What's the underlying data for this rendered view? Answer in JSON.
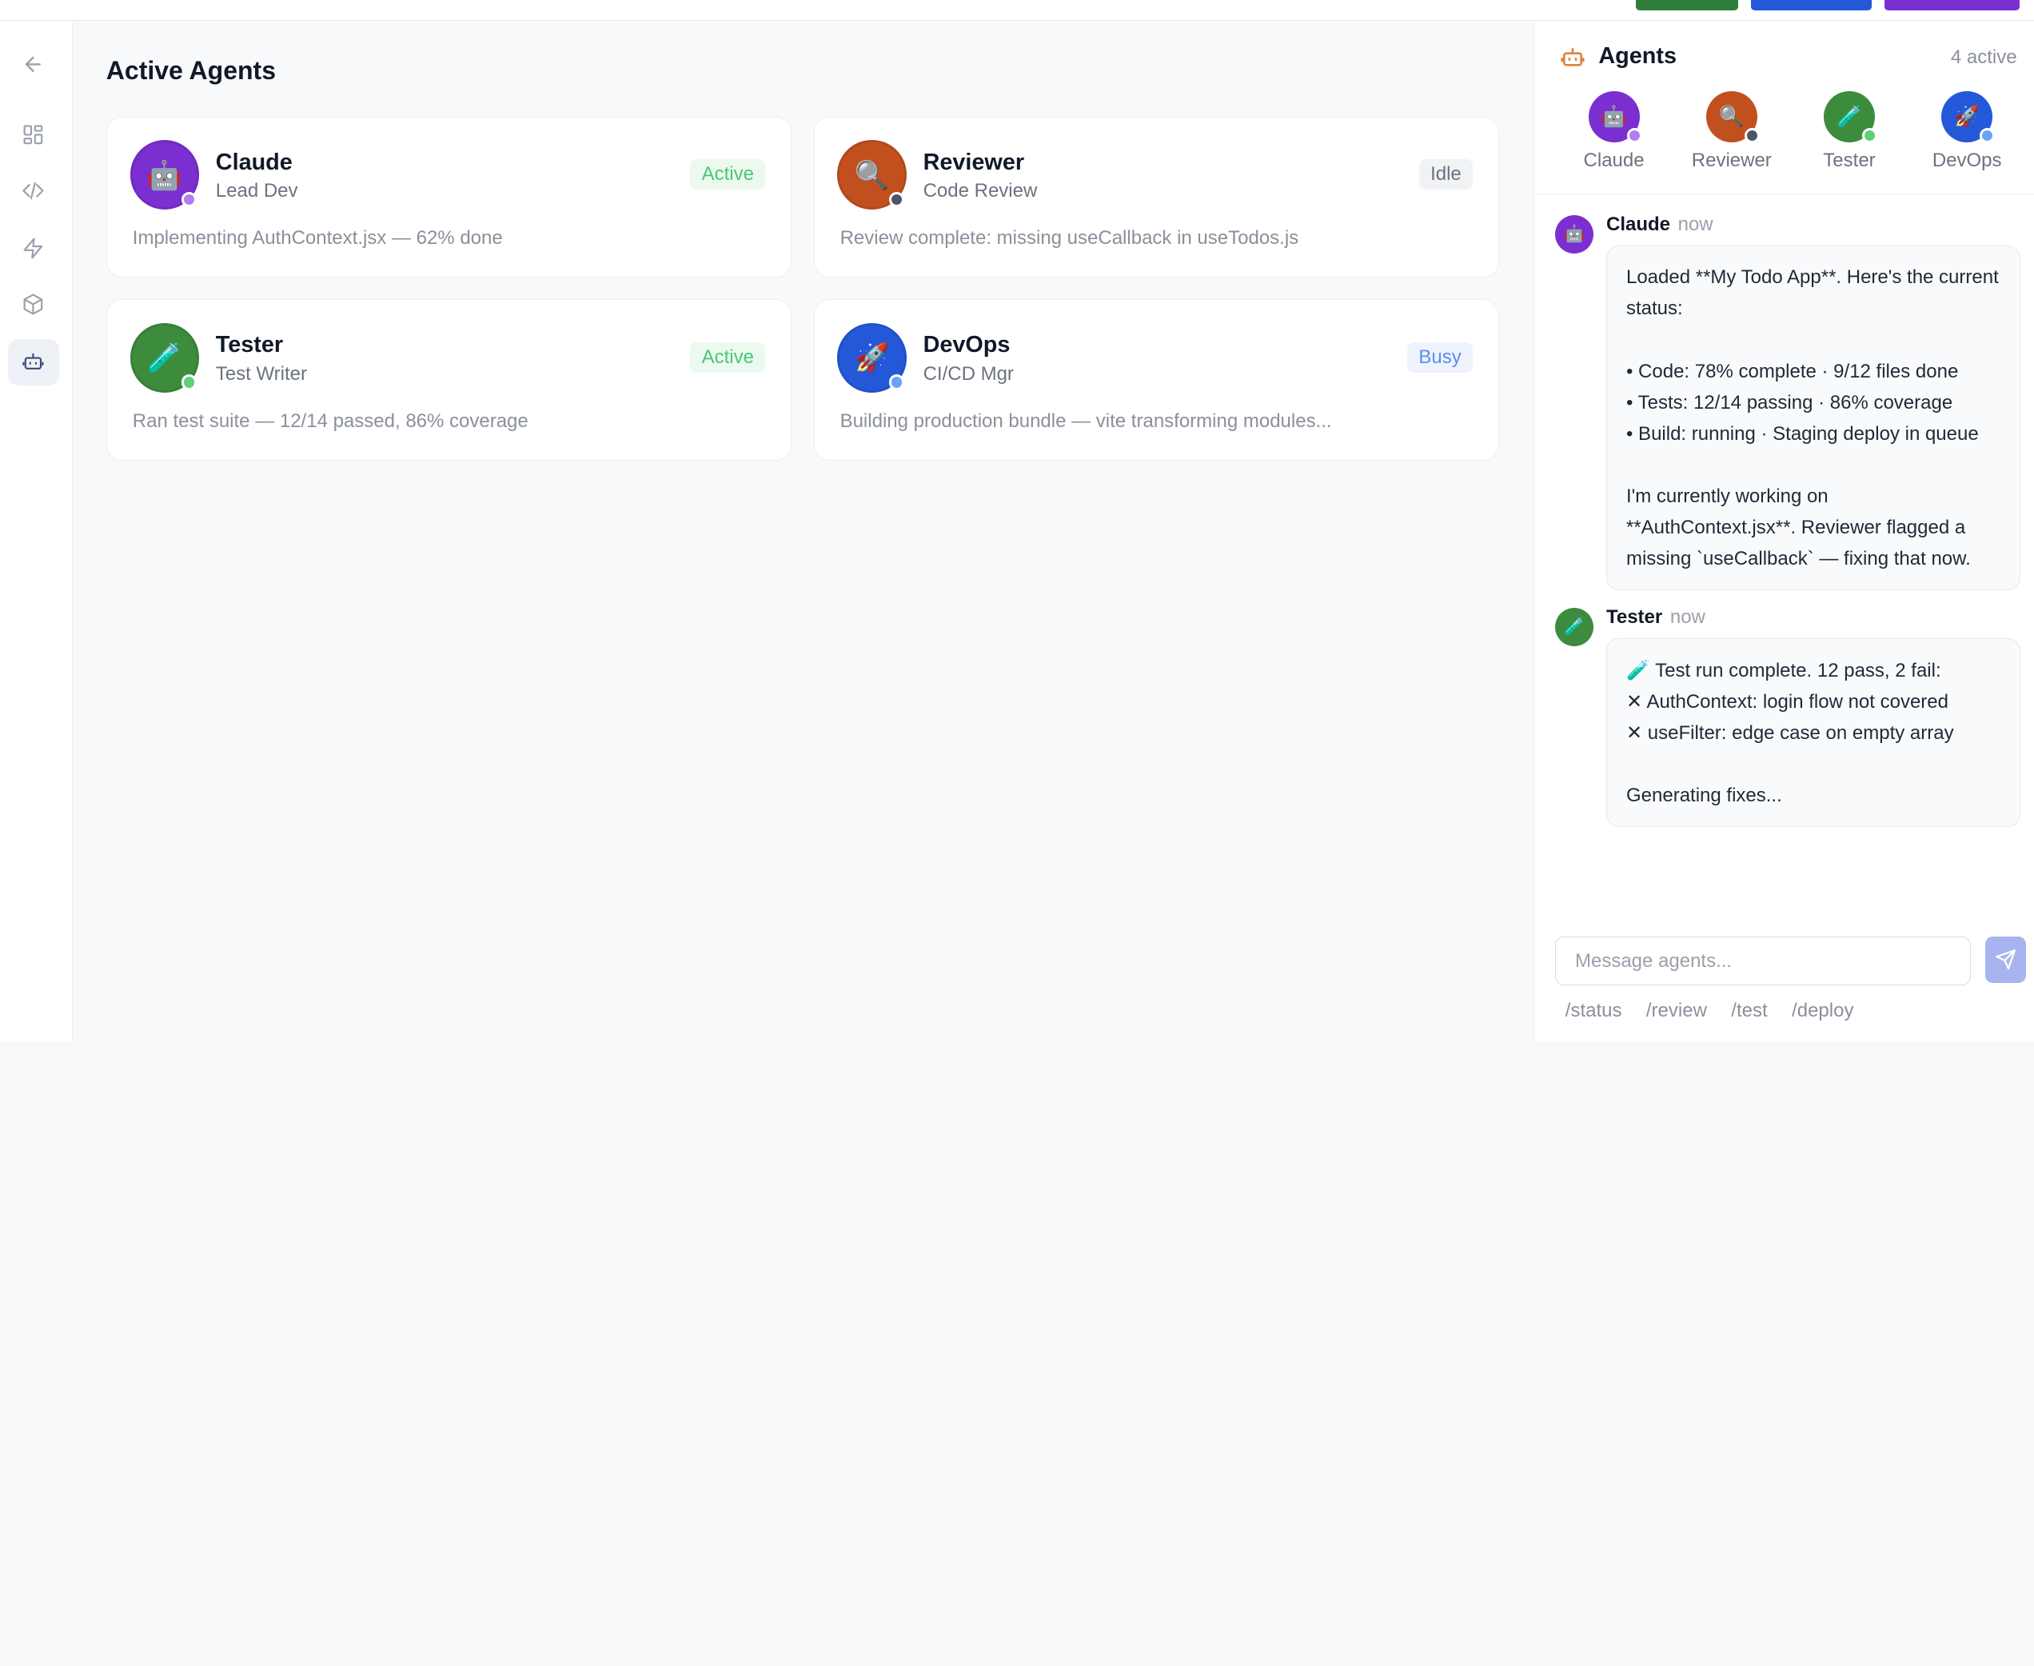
{
  "main": {
    "title": "Active Agents",
    "agents": [
      {
        "name": "Claude",
        "role": "Lead Dev",
        "status": "Active",
        "detail": "Implementing AuthContext.jsx — 62% done",
        "icon": "🤖",
        "color": "#7b2fd0",
        "dot": "#b47cf2",
        "badge_bg": "#ecf9ef",
        "badge_fg": "#48c774"
      },
      {
        "name": "Reviewer",
        "role": "Code Review",
        "status": "Idle",
        "detail": "Review complete: missing useCallback in useTodos.js",
        "icon": "🔍",
        "color": "#c2501f",
        "dot": "#4b5563",
        "badge_bg": "#f1f2f4",
        "badge_fg": "#6b7280"
      },
      {
        "name": "Tester",
        "role": "Test Writer",
        "status": "Active",
        "detail": "Ran test suite — 12/14 passed, 86% coverage",
        "icon": "🧪",
        "color": "#3d8b3d",
        "dot": "#5fd07a",
        "badge_bg": "#ecf9ef",
        "badge_fg": "#48c774"
      },
      {
        "name": "DevOps",
        "role": "CI/CD Mgr",
        "status": "Busy",
        "detail": "Building production bundle — vite transforming modules...",
        "icon": "🚀",
        "color": "#2358d8",
        "dot": "#6aa3f5",
        "badge_bg": "#eef3fd",
        "badge_fg": "#5b8def"
      }
    ]
  },
  "panel": {
    "title": "Agents",
    "count": "4 active",
    "messages": [
      {
        "author": "Claude",
        "time": "now",
        "icon": "🤖",
        "color": "#7b2fd0",
        "text": "Loaded **My Todo App**. Here's the current status:\n\n• Code: 78% complete · 9/12 files done\n• Tests: 12/14 passing · 86% coverage\n• Build: running · Staging deploy in queue\n\nI'm currently working on **AuthContext.jsx**. Reviewer flagged a missing `useCallback` — fixing that now."
      },
      {
        "author": "Tester",
        "time": "now",
        "icon": "🧪",
        "color": "#3d8b3d",
        "text": "🧪 Test run complete. 12 pass, 2 fail:\n  ✕ AuthContext: login flow not covered\n  ✕ useFilter: edge case on empty array\n\nGenerating fixes..."
      }
    ],
    "input_placeholder": "Message agents...",
    "commands": [
      "/status",
      "/review",
      "/test",
      "/deploy"
    ]
  },
  "rail": {
    "items": [
      "back-arrow-icon",
      "dashboard-icon",
      "code-icon",
      "lightning-icon",
      "package-icon",
      "bot-icon"
    ],
    "active": "bot-icon"
  },
  "topbar": {
    "button_colors": [
      "#2f7d3a",
      "#2358d8",
      "#7b2fd0"
    ]
  }
}
